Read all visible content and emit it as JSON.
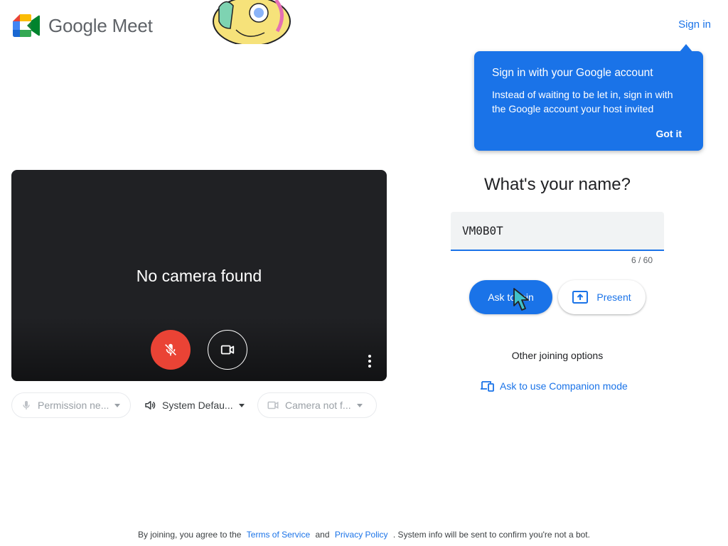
{
  "header": {
    "brand": "Google Meet",
    "sign_in": "Sign in"
  },
  "tooltip": {
    "title": "Sign in with your Google account",
    "body": "Instead of waiting to be let in, sign in with the Google account your host invited",
    "dismiss": "Got it"
  },
  "preview": {
    "status": "No camera found",
    "mic_icon": "mic-off-icon",
    "camera_icon": "videocam-icon"
  },
  "devices": {
    "microphone": "Permission ne...",
    "speaker": "System Defau...",
    "camera": "Camera not f..."
  },
  "join": {
    "question": "What's your name?",
    "name_value": "VM0B0T",
    "char_count": "6 / 60",
    "ask_button": "Ask to join",
    "present_button": "Present",
    "other_options": "Other joining options",
    "companion_link": "Ask to use Companion mode"
  },
  "footer": {
    "prefix": "By joining, you agree to the",
    "terms": "Terms of Service",
    "and": "and",
    "privacy": "Privacy Policy",
    "suffix": ". System info will be sent to confirm you're not a bot."
  },
  "colors": {
    "accent": "#1a73e8",
    "mic_off": "#ea4335",
    "preview_bg": "#202124"
  }
}
